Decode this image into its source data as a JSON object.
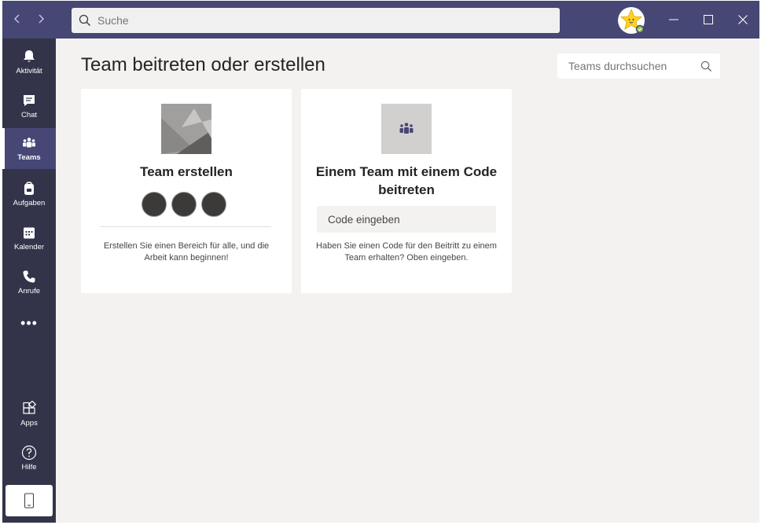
{
  "search": {
    "placeholder": "Suche"
  },
  "sidebar": {
    "items": [
      {
        "label": "Aktivität",
        "icon": "bell-icon"
      },
      {
        "label": "Chat",
        "icon": "chat-icon"
      },
      {
        "label": "Teams",
        "icon": "teams-icon",
        "active": true
      },
      {
        "label": "Aufgaben",
        "icon": "backpack-icon"
      },
      {
        "label": "Kalender",
        "icon": "calendar-icon"
      },
      {
        "label": "Anrufe",
        "icon": "phone-icon"
      }
    ],
    "more": "•••",
    "bottom": [
      {
        "label": "Apps",
        "icon": "apps-icon"
      },
      {
        "label": "Hilfe",
        "icon": "help-icon"
      }
    ]
  },
  "main": {
    "title": "Team beitreten oder erstellen",
    "teams_search_placeholder": "Teams durchsuchen",
    "create_card": {
      "title": "Team erstellen",
      "description": "Erstellen Sie einen Bereich für alle, und die Arbeit kann beginnen!"
    },
    "join_card": {
      "title": "Einem Team mit einem Code beitreten",
      "code_placeholder": "Code eingeben",
      "description": "Haben Sie einen Code für den Beitritt zu einem Team erhalten? Oben eingeben."
    }
  },
  "colors": {
    "titlebar": "#464775",
    "sidebar": "#33344a",
    "background": "#f3f2f1",
    "accent": "#6264a7"
  }
}
